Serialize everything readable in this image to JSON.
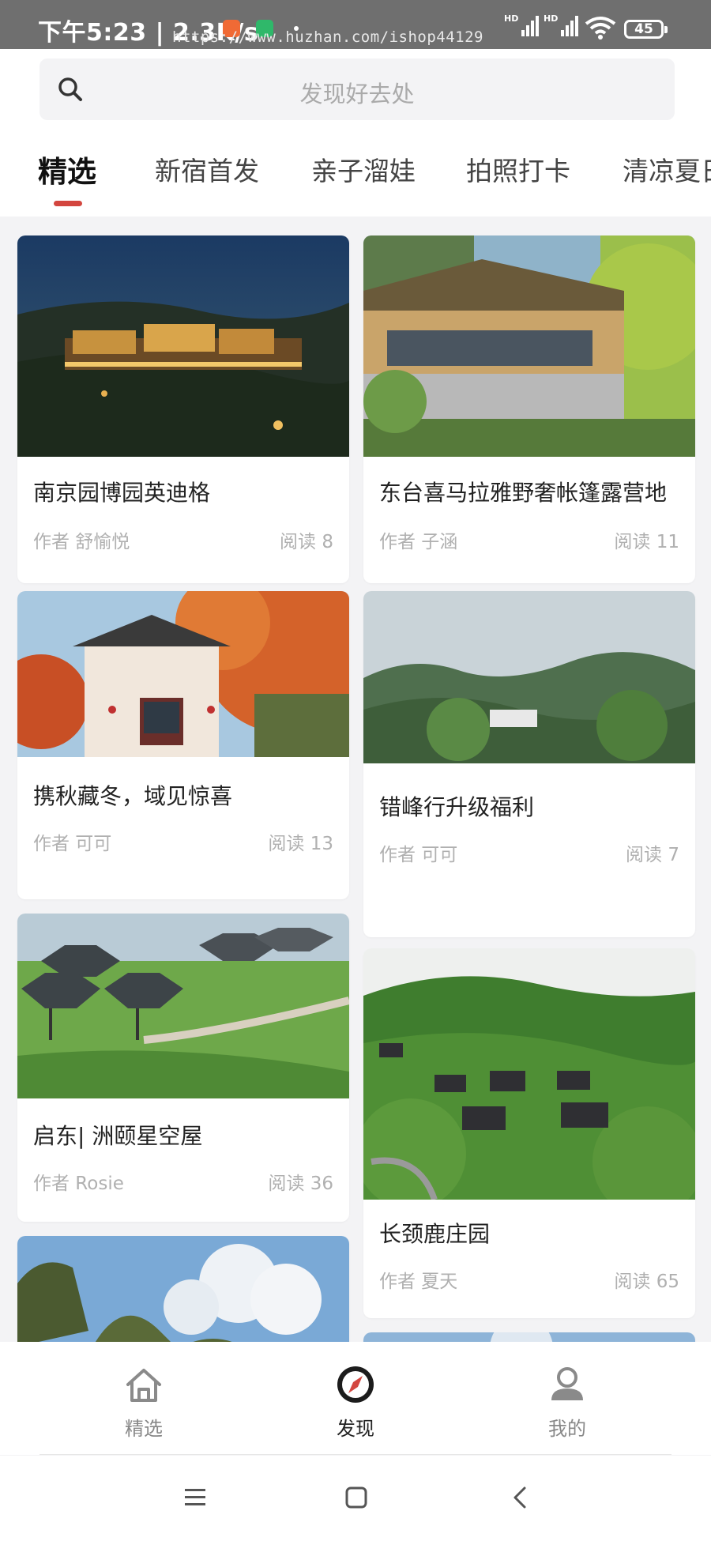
{
  "status_bar": {
    "time": "下午5:23 | 2.3K/s",
    "battery": "45",
    "signal_label": "HD"
  },
  "overlay_url": "https://www.huzhan.com/ishop44129",
  "search": {
    "placeholder": "发现好去处"
  },
  "tabs": [
    {
      "label": "精选",
      "active": true
    },
    {
      "label": "新宿首发"
    },
    {
      "label": "亲子溜娃"
    },
    {
      "label": "拍照打卡"
    },
    {
      "label": "清凉夏日"
    }
  ],
  "cards": [
    {
      "title": "南京园博园英迪格",
      "author": "作者 舒愉悦",
      "reads": "阅读 8",
      "image": "night-resort-photo"
    },
    {
      "title": "东台喜马拉雅野奢帐篷露营地",
      "author": "作者 子涵",
      "reads": "阅读 11",
      "image": "tent-lodge-photo"
    },
    {
      "title": "携秋藏冬，域见惊喜",
      "author": "作者 可可",
      "reads": "阅读 13",
      "image": "autumn-house-photo"
    },
    {
      "title": "错峰行升级福利",
      "author": "作者 可可",
      "reads": "阅读 7",
      "image": "forest-hills-photo"
    },
    {
      "title": "启东| 洲颐星空屋",
      "author": "作者 Rosie",
      "reads": "阅读 36",
      "image": "hexagon-cabins-photo"
    },
    {
      "title": "长颈鹿庄园",
      "author": "作者 夏天",
      "reads": "阅读 65",
      "image": "bamboo-villas-photo"
    },
    {
      "title": "",
      "author": "",
      "reads": "",
      "image": "karst-mountains-photo"
    },
    {
      "title": "",
      "author": "",
      "reads": "",
      "image": "sky-photo"
    }
  ],
  "bottom_nav": [
    {
      "label": "精选",
      "icon": "home-icon"
    },
    {
      "label": "发现",
      "icon": "compass-icon",
      "active": true
    },
    {
      "label": "我的",
      "icon": "user-icon"
    }
  ],
  "colors": {
    "accent": "#d3463f",
    "status_bar": "#6f6f6f"
  }
}
